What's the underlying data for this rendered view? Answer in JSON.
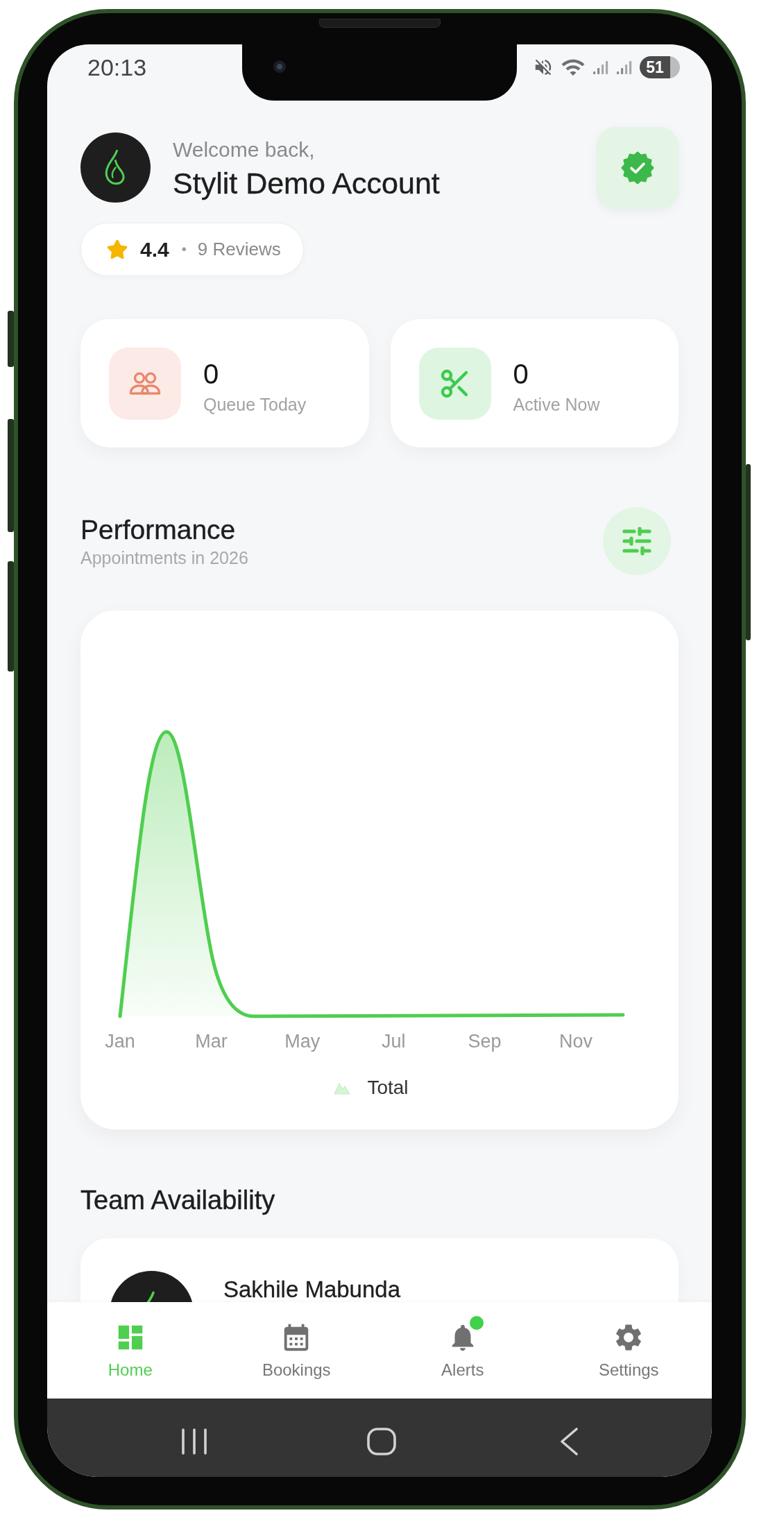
{
  "status_bar": {
    "time": "20:13",
    "battery": "51"
  },
  "header": {
    "greeting": "Welcome back,",
    "account_name": "Stylit Demo Account"
  },
  "rating": {
    "score": "4.4",
    "separator": "•",
    "reviews": "9 Reviews"
  },
  "stats": [
    {
      "value": "0",
      "label": "Queue Today",
      "color": "#e8866a"
    },
    {
      "value": "0",
      "label": "Active Now",
      "color": "#3ec94e"
    }
  ],
  "performance": {
    "title": "Performance",
    "subtitle": "Appointments in 2026",
    "chart": {
      "x_labels": [
        "Jan",
        "Mar",
        "May",
        "Jul",
        "Sep",
        "Nov"
      ],
      "legend": "Total"
    }
  },
  "team": {
    "title": "Team Availability",
    "members": [
      {
        "name": "Sakhile Mabunda"
      }
    ]
  },
  "bottom_nav": [
    {
      "label": "Home",
      "selected": true,
      "badge": false
    },
    {
      "label": "Bookings",
      "selected": false,
      "badge": false
    },
    {
      "label": "Alerts",
      "selected": false,
      "badge": true
    },
    {
      "label": "Settings",
      "selected": false,
      "badge": false
    }
  ]
}
